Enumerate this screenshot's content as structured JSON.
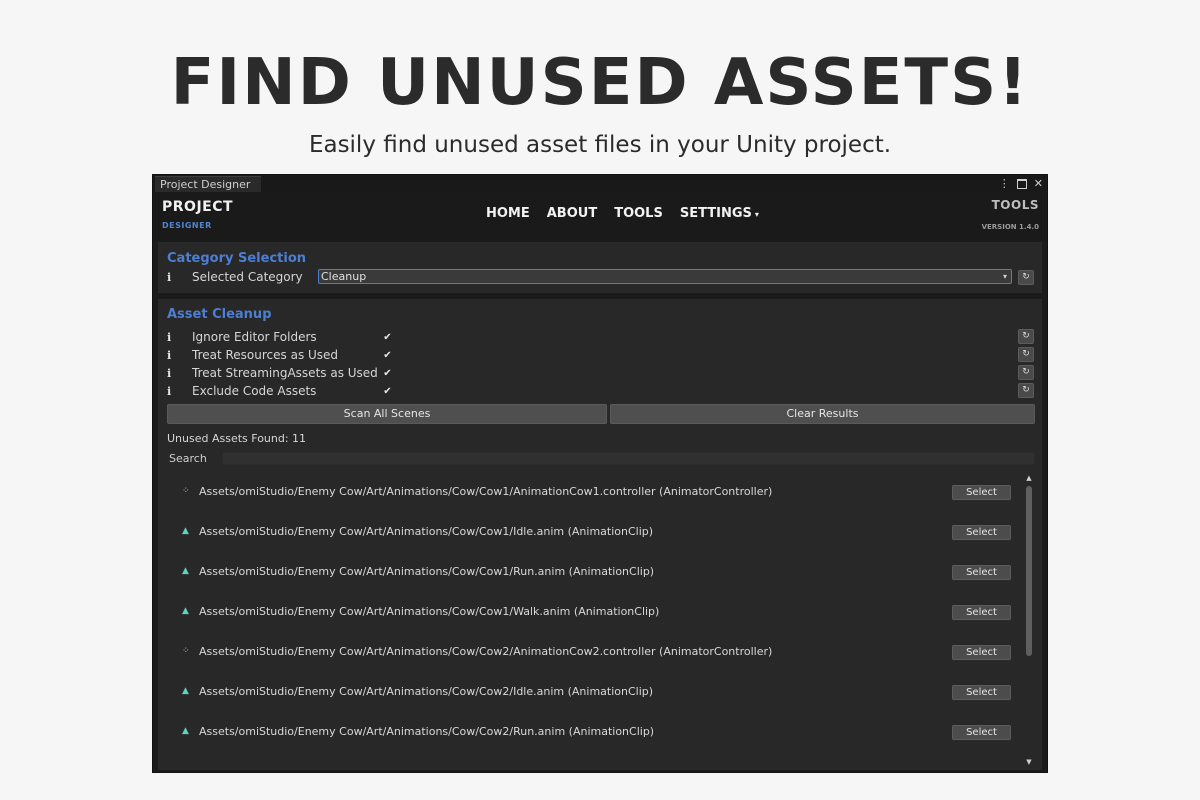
{
  "hero": {
    "title": "FIND UNUSED ASSETS!",
    "subtitle": "Easily find unused asset files in your Unity project."
  },
  "window": {
    "tab": "Project Designer",
    "controls": {
      "menu": "⋮",
      "close": "✕"
    }
  },
  "header": {
    "logo_main": "PROJECT",
    "logo_sub": "DESIGNER",
    "nav": [
      "HOME",
      "ABOUT",
      "TOOLS",
      "SETTINGS"
    ],
    "settings_caret": "▾",
    "tools_label": "TOOLS",
    "version": "VERSION 1.4.0"
  },
  "category": {
    "title": "Category Selection",
    "info": "i",
    "label": "Selected Category",
    "value": "Cleanup",
    "arrow": "▾"
  },
  "cleanup": {
    "title": "Asset Cleanup",
    "options": [
      {
        "info": "i",
        "label": "Ignore Editor Folders",
        "checked": true
      },
      {
        "info": "i",
        "label": "Treat Resources as Used",
        "checked": true
      },
      {
        "info": "i",
        "label": "Treat StreamingAssets as Used",
        "checked": true
      },
      {
        "info": "i",
        "label": "Exclude Code Assets",
        "checked": true
      }
    ],
    "check_glyph": "✔",
    "reset_glyph": "↻",
    "scan_button": "Scan All Scenes",
    "clear_button": "Clear Results",
    "found_text": "Unused Assets Found: 11",
    "search_label": "Search",
    "search_value": ""
  },
  "results": {
    "select_label": "Select",
    "items": [
      {
        "icon": "animator-controller-icon",
        "path": "Assets/omiStudio/Enemy Cow/Art/Animations/Cow/Cow1/AnimationCow1.controller  (AnimatorController)"
      },
      {
        "icon": "animation-clip-icon",
        "path": "Assets/omiStudio/Enemy Cow/Art/Animations/Cow/Cow1/Idle.anim  (AnimationClip)"
      },
      {
        "icon": "animation-clip-icon",
        "path": "Assets/omiStudio/Enemy Cow/Art/Animations/Cow/Cow1/Run.anim  (AnimationClip)"
      },
      {
        "icon": "animation-clip-icon",
        "path": "Assets/omiStudio/Enemy Cow/Art/Animations/Cow/Cow1/Walk.anim  (AnimationClip)"
      },
      {
        "icon": "animator-controller-icon",
        "path": "Assets/omiStudio/Enemy Cow/Art/Animations/Cow/Cow2/AnimationCow2.controller  (AnimatorController)"
      },
      {
        "icon": "animation-clip-icon",
        "path": "Assets/omiStudio/Enemy Cow/Art/Animations/Cow/Cow2/Idle.anim  (AnimationClip)"
      },
      {
        "icon": "animation-clip-icon",
        "path": "Assets/omiStudio/Enemy Cow/Art/Animations/Cow/Cow2/Run.anim  (AnimationClip)"
      }
    ],
    "scroll_up": "▲",
    "scroll_down": "▼"
  },
  "colors": {
    "accent": "#4c7fd3",
    "clip_icon": "#5fd0c0",
    "panel": "#282828",
    "window": "#1b1b1b"
  }
}
